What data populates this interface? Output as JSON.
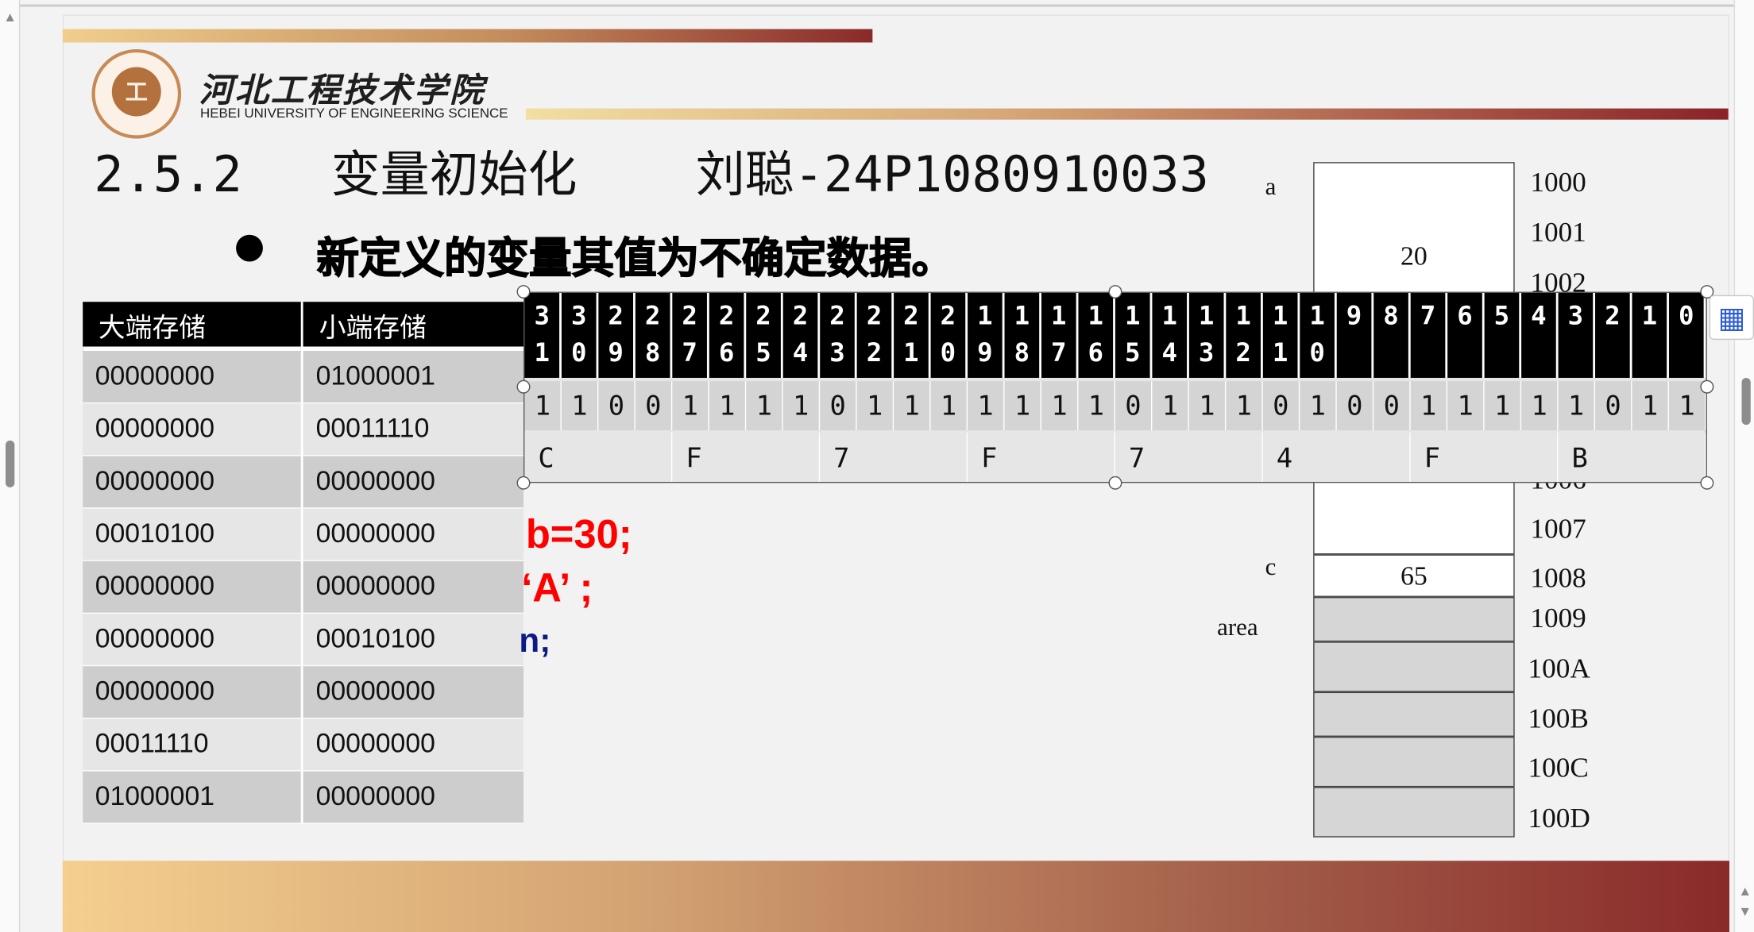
{
  "header": {
    "university_cn": "河北工程技术学院",
    "university_en": "HEBEI UNIVERSITY OF ENGINEERING SCIENCE",
    "emblem_icon": "university-emblem"
  },
  "slide": {
    "title": "2.5.2   变量初始化    刘聪-24P1080910033",
    "bullet_text": "新定义的变量其值为不确定数据。",
    "code_fragments": [
      "b=30;",
      "‘A’ ;",
      "n;"
    ]
  },
  "endian_table": {
    "headers": [
      "大端存储",
      "小端存储"
    ],
    "rows": [
      [
        "00000000",
        "01000001"
      ],
      [
        "00000000",
        "00011110"
      ],
      [
        "00000000",
        "00000000"
      ],
      [
        "00010100",
        "00000000"
      ],
      [
        "00000000",
        "00000000"
      ],
      [
        "00000000",
        "00010100"
      ],
      [
        "00000000",
        "00000000"
      ],
      [
        "00011110",
        "00000000"
      ],
      [
        "01000001",
        "00000000"
      ]
    ]
  },
  "memory": {
    "labels": {
      "a": "a",
      "c": "c",
      "area": "area"
    },
    "values": {
      "a": "20",
      "c": "65"
    },
    "addresses": [
      "1000",
      "1001",
      "1002",
      "1006",
      "1007",
      "1008",
      "1009",
      "100A",
      "100B",
      "100C",
      "100D"
    ]
  },
  "bit_overlay": {
    "bit_indices": [
      [
        "3",
        "1"
      ],
      [
        "3",
        "0"
      ],
      [
        "2",
        "9"
      ],
      [
        "2",
        "8"
      ],
      [
        "2",
        "7"
      ],
      [
        "2",
        "6"
      ],
      [
        "2",
        "5"
      ],
      [
        "2",
        "4"
      ],
      [
        "2",
        "3"
      ],
      [
        "2",
        "2"
      ],
      [
        "2",
        "1"
      ],
      [
        "2",
        "0"
      ],
      [
        "1",
        "9"
      ],
      [
        "1",
        "8"
      ],
      [
        "1",
        "7"
      ],
      [
        "1",
        "6"
      ],
      [
        "1",
        "5"
      ],
      [
        "1",
        "4"
      ],
      [
        "1",
        "3"
      ],
      [
        "1",
        "2"
      ],
      [
        "1",
        "1"
      ],
      [
        "1",
        "0"
      ],
      [
        "9",
        ""
      ],
      [
        "8",
        ""
      ],
      [
        "7",
        ""
      ],
      [
        "6",
        ""
      ],
      [
        "5",
        ""
      ],
      [
        "4",
        ""
      ],
      [
        "3",
        ""
      ],
      [
        "2",
        ""
      ],
      [
        "1",
        ""
      ],
      [
        "0",
        ""
      ]
    ],
    "bits": [
      "1",
      "1",
      "0",
      "0",
      "1",
      "1",
      "1",
      "1",
      "0",
      "1",
      "1",
      "1",
      "1",
      "1",
      "1",
      "1",
      "0",
      "1",
      "1",
      "1",
      "0",
      "1",
      "0",
      "0",
      "1",
      "1",
      "1",
      "1",
      "1",
      "0",
      "1",
      "1"
    ],
    "hex": [
      "C",
      "F",
      "7",
      "F",
      "7",
      "4",
      "F",
      "B"
    ]
  },
  "ui": {
    "float_button_icon": "table-layout-icon",
    "scroll_up_icon": "scroll-up-icon",
    "scroll_down_icon": "scroll-down-icon"
  },
  "colors": {
    "accent_dark_red": "#8a2a2a",
    "gold": "#f0ce8d",
    "code_red": "#ff0000",
    "code_blue": "#0b1a86"
  }
}
